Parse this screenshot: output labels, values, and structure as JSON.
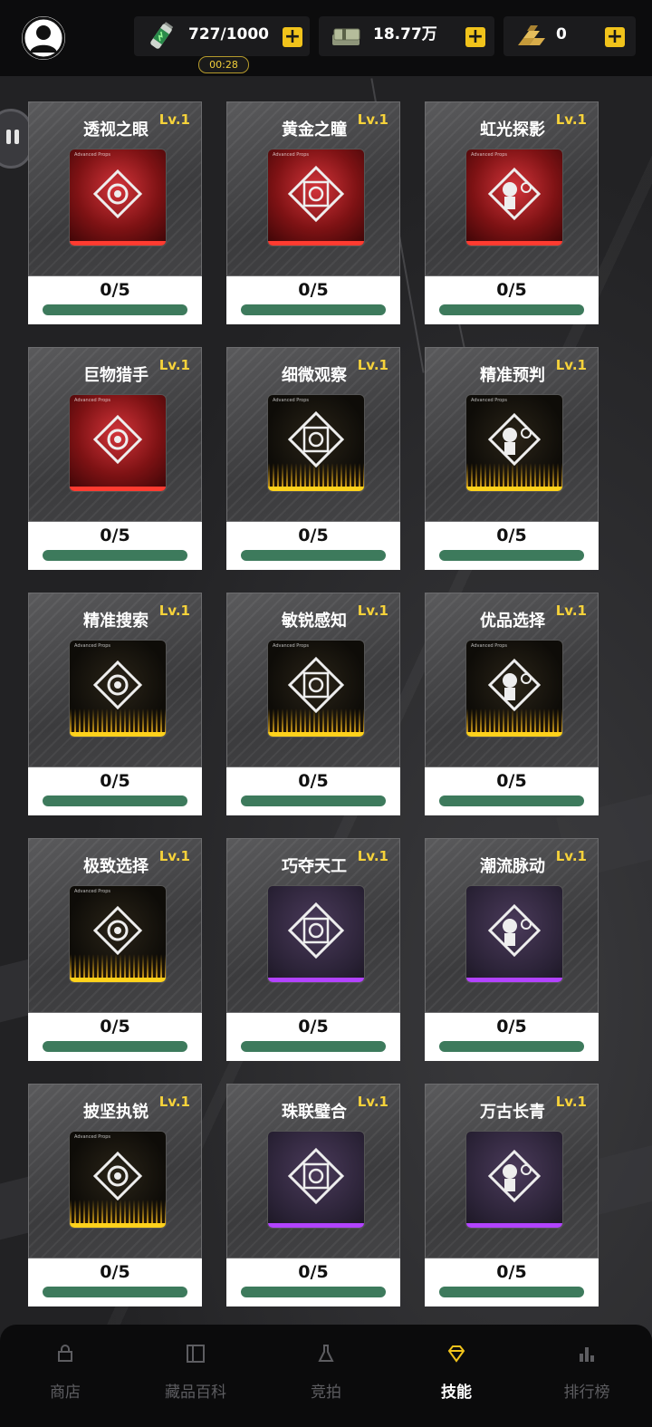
{
  "header": {
    "energy": {
      "value": "727/1000",
      "timer": "00:28",
      "icon": "energy-drink-icon"
    },
    "cash": {
      "value": "18.77万",
      "icon": "cash-stack-icon"
    },
    "gold": {
      "value": "0",
      "icon": "gold-bars-icon"
    },
    "plus_label": "+"
  },
  "colors": {
    "accent": "#f1c31b",
    "level": "#f6d23a",
    "progress": "#3d7a5c",
    "rarity_red": "#ff3b30",
    "rarity_gold": "#ffd21c",
    "rarity_purple": "#b243ff"
  },
  "skills": [
    {
      "name": "透视之眼",
      "level": "Lv.1",
      "count": "0/5",
      "progress": 0,
      "rarity": "red",
      "art_tag": "Advanced Props"
    },
    {
      "name": "黄金之瞳",
      "level": "Lv.1",
      "count": "0/5",
      "progress": 0,
      "rarity": "red",
      "art_tag": "Advanced Props"
    },
    {
      "name": "虹光探影",
      "level": "Lv.1",
      "count": "0/5",
      "progress": 0,
      "rarity": "red",
      "art_tag": "Advanced Props"
    },
    {
      "name": "巨物猎手",
      "level": "Lv.1",
      "count": "0/5",
      "progress": 0,
      "rarity": "red",
      "art_tag": "Advanced Props"
    },
    {
      "name": "细微观察",
      "level": "Lv.1",
      "count": "0/5",
      "progress": 0,
      "rarity": "gold",
      "art_tag": "Advanced Props"
    },
    {
      "name": "精准预判",
      "level": "Lv.1",
      "count": "0/5",
      "progress": 0,
      "rarity": "gold",
      "art_tag": "Advanced Props"
    },
    {
      "name": "精准搜索",
      "level": "Lv.1",
      "count": "0/5",
      "progress": 0,
      "rarity": "gold",
      "art_tag": "Advanced Props"
    },
    {
      "name": "敏锐感知",
      "level": "Lv.1",
      "count": "0/5",
      "progress": 0,
      "rarity": "gold",
      "art_tag": "Advanced Props"
    },
    {
      "name": "优品选择",
      "level": "Lv.1",
      "count": "0/5",
      "progress": 0,
      "rarity": "gold",
      "art_tag": "Advanced Props"
    },
    {
      "name": "极致选择",
      "level": "Lv.1",
      "count": "0/5",
      "progress": 0,
      "rarity": "gold",
      "art_tag": "Advanced Props"
    },
    {
      "name": "巧夺天工",
      "level": "Lv.1",
      "count": "0/5",
      "progress": 0,
      "rarity": "purple",
      "art_tag": ""
    },
    {
      "name": "潮流脉动",
      "level": "Lv.1",
      "count": "0/5",
      "progress": 0,
      "rarity": "purple",
      "art_tag": ""
    },
    {
      "name": "披坚执锐",
      "level": "Lv.1",
      "count": "0/5",
      "progress": 0,
      "rarity": "gold",
      "art_tag": "Advanced Props"
    },
    {
      "name": "珠联璧合",
      "level": "Lv.1",
      "count": "0/5",
      "progress": 0,
      "rarity": "purple",
      "art_tag": ""
    },
    {
      "name": "万古长青",
      "level": "Lv.1",
      "count": "0/5",
      "progress": 0,
      "rarity": "purple",
      "art_tag": ""
    }
  ],
  "nav": [
    {
      "label": "商店",
      "icon": "shop-bag-icon",
      "active": false
    },
    {
      "label": "藏品百科",
      "icon": "book-icon",
      "active": false
    },
    {
      "label": "竞拍",
      "icon": "flask-icon",
      "active": false
    },
    {
      "label": "技能",
      "icon": "diamond-gem-icon",
      "active": true
    },
    {
      "label": "排行榜",
      "icon": "bar-chart-icon",
      "active": false
    }
  ]
}
